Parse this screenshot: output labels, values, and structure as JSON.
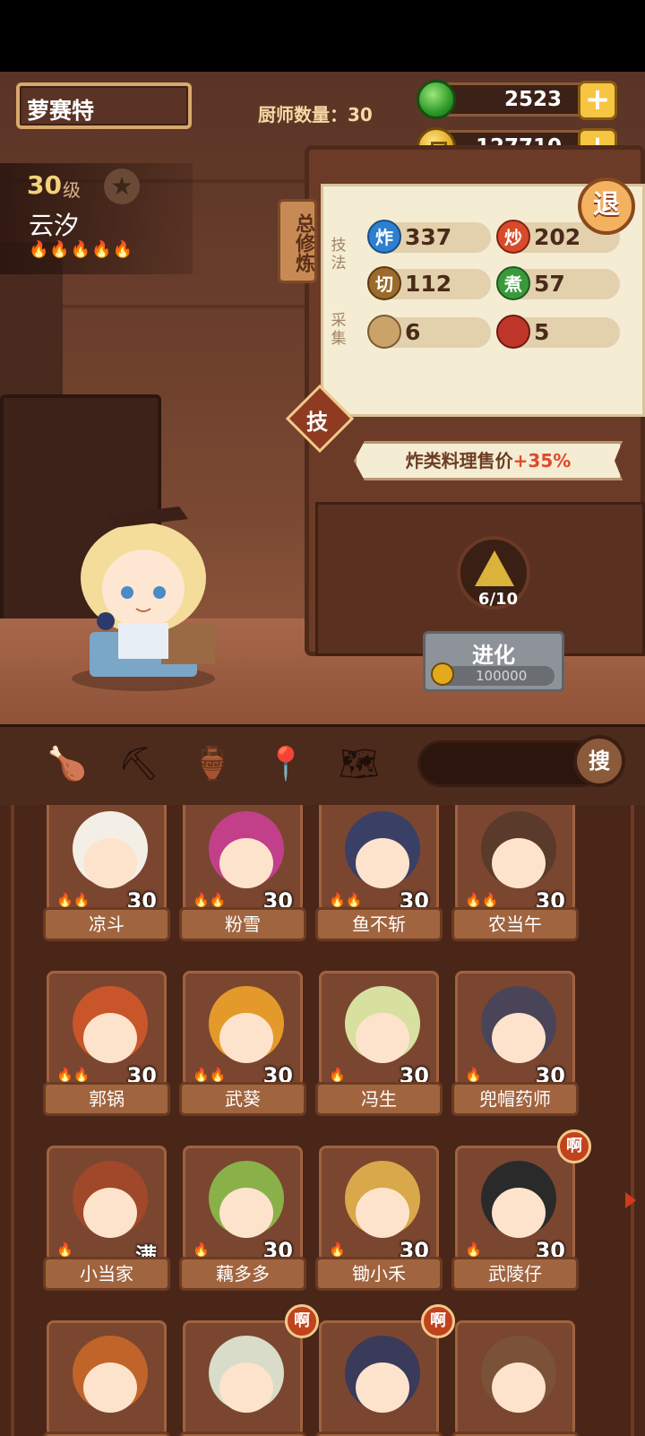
{
  "header": {
    "player_name": "萝赛特",
    "chef_count": "厨师数量：30",
    "gems": "2523",
    "coins": "127710",
    "plus": "+"
  },
  "chef": {
    "level": "30",
    "level_unit": "级",
    "name": "云汐",
    "flames": "🔥🔥🔥🔥🔥"
  },
  "panel": {
    "tab": "总修炼",
    "technique_label": "技法",
    "gather_label": "采集",
    "skills": [
      {
        "icon": "炸",
        "value": "337",
        "color": "#2d7fd0"
      },
      {
        "icon": "炒",
        "value": "202",
        "color": "#d84a2a"
      },
      {
        "icon": "切",
        "value": "112",
        "color": "#9c6a2a"
      },
      {
        "icon": "煮",
        "value": "57",
        "color": "#3a9a3a"
      },
      {
        "icon": "",
        "value": "6",
        "color": "#c9a36a"
      },
      {
        "icon": "",
        "value": "5",
        "color": "#c0352a"
      }
    ],
    "skill_badge": "技",
    "bonus_prefix": "炸类料理售价",
    "bonus_value": "+35%",
    "evolution_progress": "6/10",
    "evolve_label": "进化",
    "evolve_cost": "100000",
    "retreat": "退"
  },
  "toolbar": {
    "search_button": "搜"
  },
  "roster": [
    {
      "name": "凉斗",
      "level": "30",
      "hair": "#f4efe6",
      "flames": "🔥🔥"
    },
    {
      "name": "粉雪",
      "level": "30",
      "hair": "#c2408a",
      "flames": "🔥🔥"
    },
    {
      "name": "鱼不斩",
      "level": "30",
      "hair": "#3a3f66",
      "flames": "🔥🔥"
    },
    {
      "name": "农当午",
      "level": "30",
      "hair": "#5a3a2a",
      "flames": "🔥🔥"
    },
    {
      "name": "郭锅",
      "level": "30",
      "hair": "#c9552a",
      "flames": "🔥🔥"
    },
    {
      "name": "武葵",
      "level": "30",
      "hair": "#e39a2a",
      "flames": "🔥🔥"
    },
    {
      "name": "冯生",
      "level": "30",
      "hair": "#d8e0a0",
      "flames": "🔥"
    },
    {
      "name": "兜帽药师",
      "level": "30",
      "hair": "#4a4458",
      "flames": "🔥"
    },
    {
      "name": "小当家",
      "level": "满",
      "hair": "#a0482a",
      "flames": "🔥",
      "alert": ""
    },
    {
      "name": "藕多多",
      "level": "30",
      "hair": "#8ab04a",
      "flames": "🔥"
    },
    {
      "name": "锄小禾",
      "level": "30",
      "hair": "#d9a84a",
      "flames": "🔥"
    },
    {
      "name": "武陵仔",
      "level": "30",
      "hair": "#2a2a2a",
      "flames": "🔥",
      "alert": "啊"
    },
    {
      "name": "",
      "level": "",
      "hair": "#c0642a",
      "flames": ""
    },
    {
      "name": "",
      "level": "",
      "hair": "#d8dcc8",
      "flames": "",
      "alert": "啊"
    },
    {
      "name": "",
      "level": "",
      "hair": "#3a3a5a",
      "flames": "",
      "alert": "啊"
    },
    {
      "name": "",
      "level": "",
      "hair": "#7a5238",
      "flames": ""
    }
  ]
}
